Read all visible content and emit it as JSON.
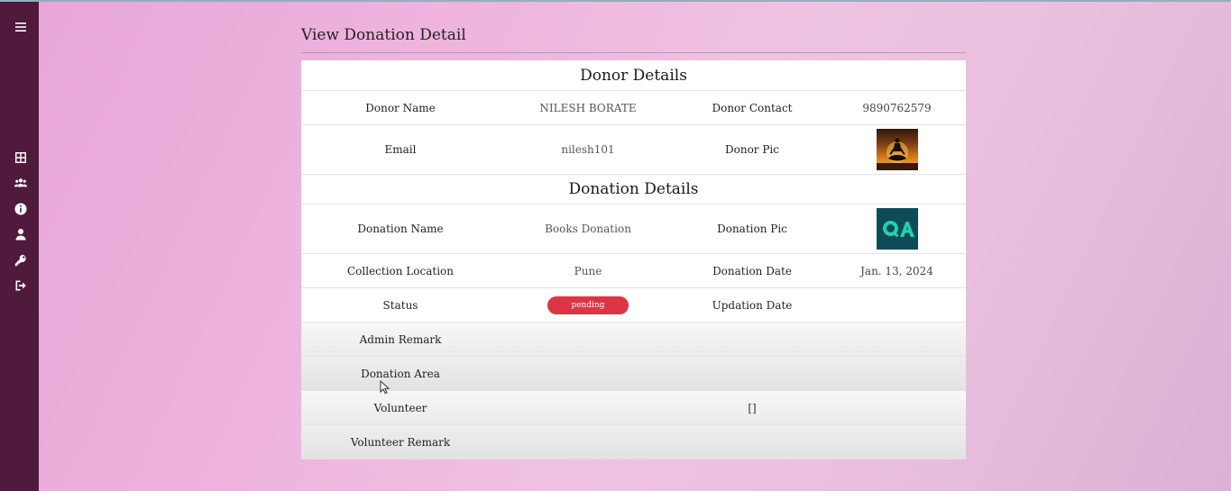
{
  "page": {
    "title": "View Donation Detail"
  },
  "sidebar": {
    "items": [
      {
        "icon": "menu-icon"
      },
      {
        "icon": "dashboard-icon"
      },
      {
        "icon": "users-icon"
      },
      {
        "icon": "info-icon"
      },
      {
        "icon": "user-icon"
      },
      {
        "icon": "key-icon"
      },
      {
        "icon": "logout-icon"
      }
    ]
  },
  "donor": {
    "section_title": "Donor Details",
    "name_label": "Donor Name",
    "name_value": "NILESH BORATE",
    "contact_label": "Donor Contact",
    "contact_value": "9890762579",
    "email_label": "Email",
    "email_value": "nilesh101",
    "pic_label": "Donor Pic"
  },
  "donation": {
    "section_title": "Donation Details",
    "name_label": "Donation Name",
    "name_value": "Books Donation",
    "pic_label": "Donation Pic",
    "location_label": "Collection Location",
    "location_value": "Pune",
    "date_label": "Donation Date",
    "date_value": "Jan. 13, 2024",
    "status_label": "Status",
    "status_value": "pending",
    "updation_label": "Updation Date",
    "updation_value": "",
    "admin_remark_label": "Admin Remark",
    "admin_remark_value": "",
    "area_label": "Donation Area",
    "area_value": "",
    "volunteer_label": "Volunteer",
    "volunteer_value": "[]",
    "volunteer_remark_label": "Volunteer Remark",
    "volunteer_remark_value": ""
  },
  "colors": {
    "sidebar_bg": "#4f1a3c",
    "status_badge": "#dc3545",
    "qa_logo_bg": "#0e4a58",
    "qa_logo_fg": "#22d3a6"
  }
}
